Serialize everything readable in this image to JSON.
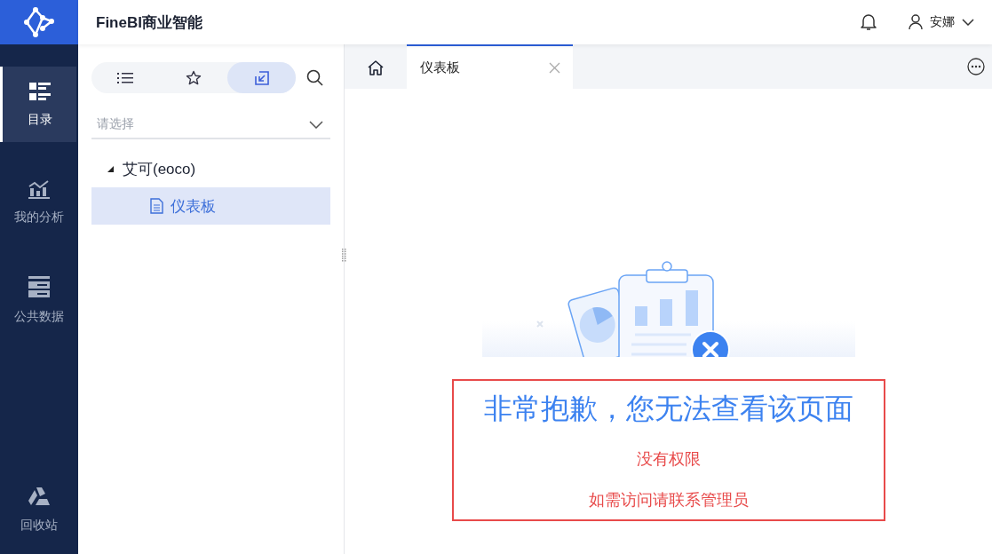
{
  "app": {
    "title": "FineBI商业智能"
  },
  "header": {
    "user": "安娜"
  },
  "nav": [
    {
      "kind": "catalog",
      "label": "目录",
      "selected": true
    },
    {
      "kind": "analysis",
      "label": "我的分析",
      "selected": false
    },
    {
      "kind": "data",
      "label": "公共数据",
      "selected": false
    },
    {
      "kind": "recycle",
      "label": "回收站",
      "selected": false
    }
  ],
  "panel": {
    "view_tabs": [
      {
        "kind": "list",
        "selected": false
      },
      {
        "kind": "star",
        "selected": false
      },
      {
        "kind": "import",
        "selected": true
      }
    ],
    "select": {
      "placeholder": "请选择"
    },
    "tree": [
      {
        "label": "艾可(eoco)",
        "expanded": true,
        "selected": false,
        "children": [
          {
            "label": "仪表板",
            "selected": true
          }
        ]
      }
    ]
  },
  "tabs": [
    {
      "kind": "home",
      "selected": false
    },
    {
      "kind": "page",
      "label": "仪表板",
      "selected": true
    }
  ],
  "message": {
    "title": "非常抱歉，您无法查看该页面",
    "lines": [
      "没有权限",
      "如需访问请联系管理员"
    ]
  }
}
